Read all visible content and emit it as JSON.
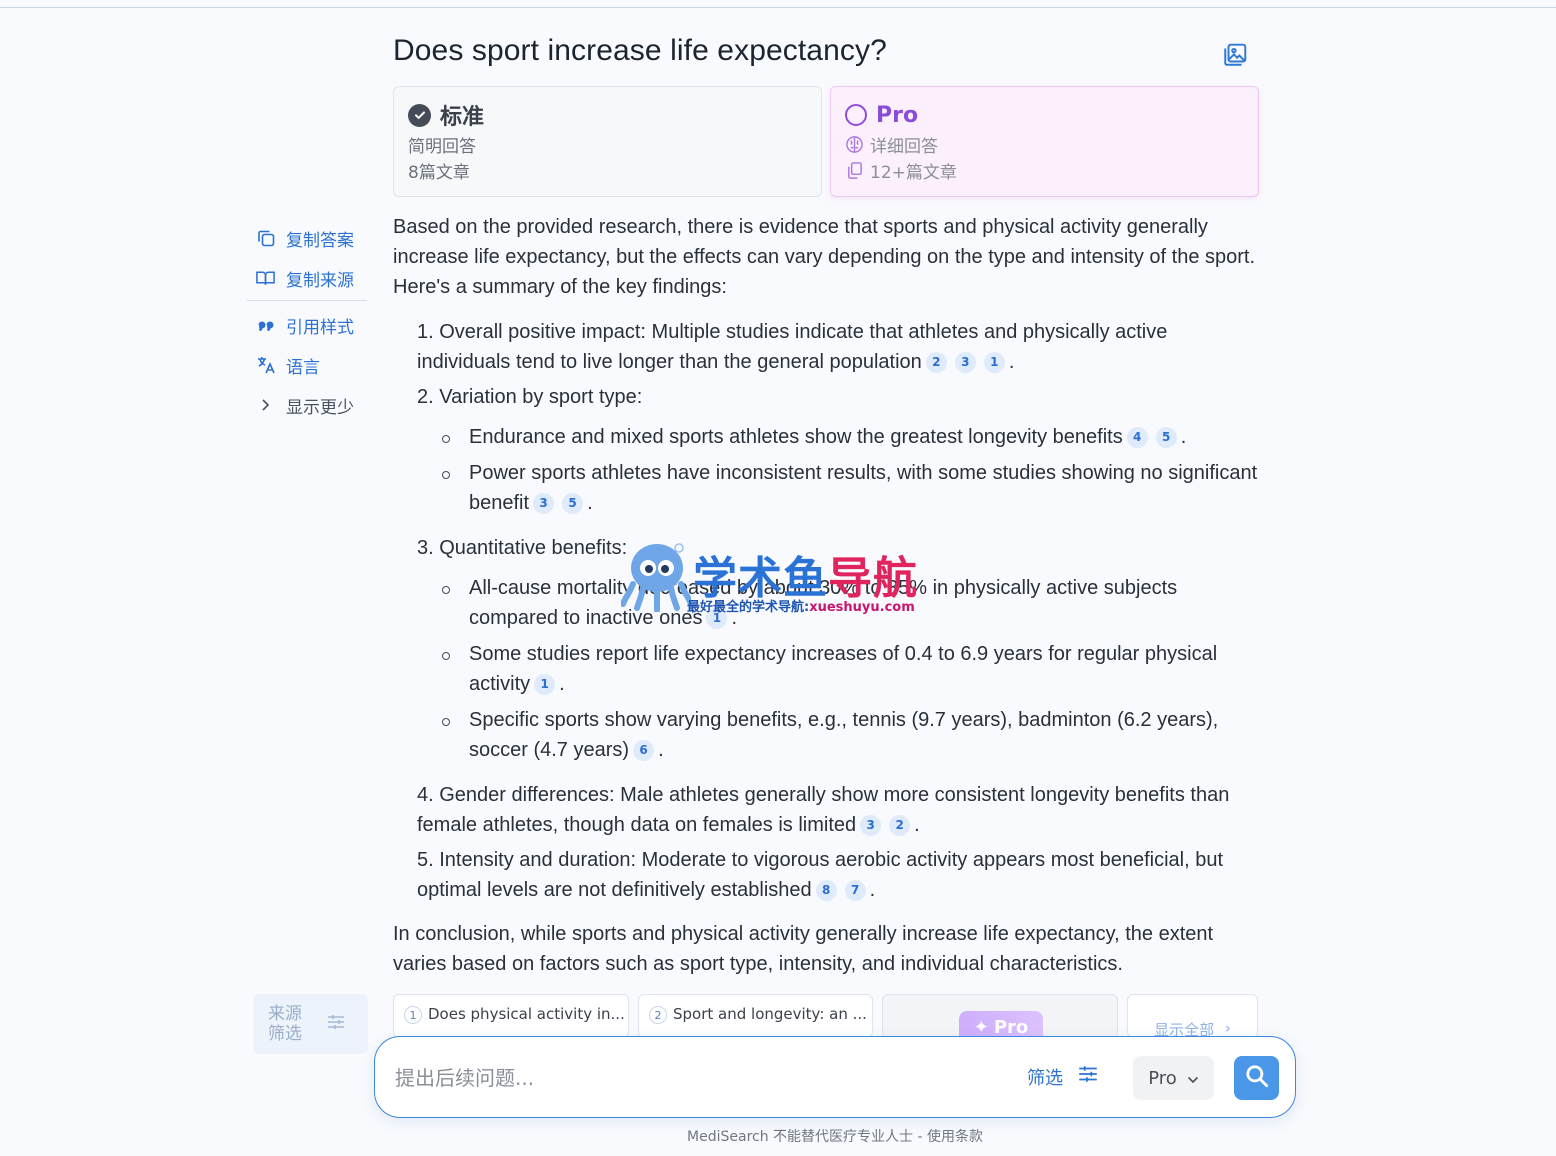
{
  "title": "Does sport increase life expectancy?",
  "modes": {
    "standard": {
      "label": "标准",
      "line1": "简明回答",
      "line2": "8篇文章"
    },
    "pro": {
      "label": "Pro",
      "line1": "详细回答",
      "line2": "12+篇文章"
    }
  },
  "actions": {
    "copy_answer": "复制答案",
    "copy_sources": "复制来源",
    "citation_style": "引用样式",
    "language": "语言",
    "show_less": "显示更少"
  },
  "answer": {
    "intro": "Based on the provided research, there is evidence that sports and physical activity generally increase life expectancy, but the effects can vary depending on the type and intensity of the sport. Here's a summary of the key findings:",
    "items": [
      {
        "text": "1. Overall positive impact: Multiple studies indicate that athletes and physically active individuals tend to live longer than the general population",
        "cites": [
          "2",
          "3",
          "1"
        ]
      },
      {
        "text": "2. Variation by sport type:"
      },
      {
        "sub": [
          {
            "text": "Endurance and mixed sports athletes show the greatest longevity benefits",
            "cites": [
              "4",
              "5"
            ]
          },
          {
            "text": "Power sports athletes have inconsistent results, with some studies showing no significant benefit",
            "cites": [
              "3",
              "5"
            ]
          }
        ]
      },
      {
        "text": "3. Quantitative benefits:"
      },
      {
        "sub": [
          {
            "text": "All-cause mortality decreased by about 30% to 35% in physically active subjects compared to inactive ones",
            "cites": [
              "1"
            ]
          },
          {
            "text": "Some studies report life expectancy increases of 0.4 to 6.9 years for regular physical activity",
            "cites": [
              "1"
            ]
          },
          {
            "text": "Specific sports show varying benefits, e.g., tennis (9.7 years), badminton (6.2 years), soccer (4.7 years)",
            "cites": [
              "6"
            ]
          }
        ]
      },
      {
        "text": "4. Gender differences: Male athletes generally show more consistent longevity benefits than female athletes, though data on females is limited",
        "cites": [
          "3",
          "2"
        ]
      },
      {
        "text": "5. Intensity and duration: Moderate to vigorous aerobic activity appears most beneficial, but optimal levels are not definitively established",
        "cites": [
          "8",
          "7"
        ]
      }
    ],
    "conclusion": "In conclusion, while sports and physical activity generally increase life expectancy, the extent varies based on factors such as sport type, intensity, and individual characteristics."
  },
  "watermark": {
    "title_blue": "学术鱼",
    "title_red": "导航",
    "sub_blue": "最好最全的学术导航:",
    "sub_mag": "xueshuyu.com"
  },
  "sources": {
    "filter_label": "来源筛选",
    "cards": [
      {
        "num": "1",
        "title": "Does physical activity in..."
      },
      {
        "num": "2",
        "title": "Sport and longevity: an ..."
      }
    ],
    "pro_badge": "Pro",
    "show_all": "显示全部"
  },
  "followup": {
    "placeholder": "提出后续问题...",
    "filter_label": "筛选",
    "mode_value": "Pro"
  },
  "footer": "MediSearch 不能替代医疗专业人士 - 使用条款",
  "colors": {
    "accent": "#2d72d2",
    "pro_purple": "#8b4dd6",
    "search_button": "#4a97e8"
  }
}
